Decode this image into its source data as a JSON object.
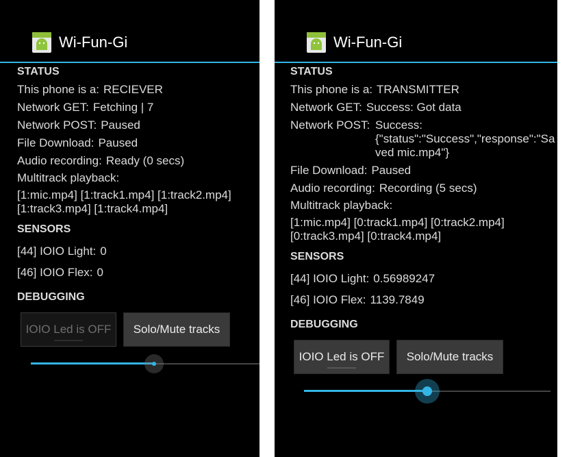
{
  "left": {
    "app_title": "Wi-Fun-Gi",
    "status_header": "STATUS",
    "phone_role_label": "This phone is a:",
    "phone_role_value": "RECIEVER",
    "net_get_label": "Network GET:",
    "net_get_value": "Fetching | 7",
    "net_post_label": "Network POST:",
    "net_post_value": "Paused",
    "file_dl_label": "File Download:",
    "file_dl_value": "Paused",
    "audio_label": "Audio recording:",
    "audio_value": "Ready (0 secs)",
    "multitrack_label": "Multitrack playback:",
    "multitrack_line1": "[1:mic.mp4] [1:track1.mp4] [1:track2.mp4]",
    "multitrack_line2": "[1:track3.mp4] [1:track4.mp4]",
    "sensors_header": "SENSORS",
    "light_label": "[44] IOIO Light:",
    "light_value": "0",
    "flex_label": "[46] IOIO Flex:",
    "flex_value": "0",
    "debug_header": "DEBUGGING",
    "led_button": "IOIO Led is OFF",
    "led_enabled": false,
    "solo_button": "Solo/Mute tracks",
    "slider_fraction": 0.54
  },
  "right": {
    "app_title": "Wi-Fun-Gi",
    "status_header": "STATUS",
    "phone_role_label": "This phone is a:",
    "phone_role_value": "TRANSMITTER",
    "net_get_label": "Network GET:",
    "net_get_value": "Success: Got data",
    "net_post_label": "Network POST:",
    "net_post_value_line1": "Success:",
    "net_post_value_line2": "{\"status\":\"Success\",\"response\":\"Sa",
    "net_post_value_line3": "ved mic.mp4\"}",
    "file_dl_label": "File Download:",
    "file_dl_value": "Paused",
    "audio_label": "Audio recording:",
    "audio_value": "Recording (5 secs)",
    "multitrack_label": "Multitrack playback:",
    "multitrack_line1": "[1:mic.mp4] [0:track1.mp4] [0:track2.mp4]",
    "multitrack_line2": "[0:track3.mp4] [0:track4.mp4]",
    "sensors_header": "SENSORS",
    "light_label": "[44] IOIO Light:",
    "light_value": "0.56989247",
    "flex_label": "[46] IOIO Flex:",
    "flex_value": "1139.7849",
    "debug_header": "DEBUGGING",
    "led_button": "IOIO Led is OFF",
    "led_enabled": true,
    "solo_button": "Solo/Mute tracks",
    "slider_fraction": 0.5
  },
  "colors": {
    "accent": "#33b5e5",
    "background": "#000000",
    "text": "#dcdcdc"
  },
  "icons": {
    "app": "android-app-icon"
  }
}
